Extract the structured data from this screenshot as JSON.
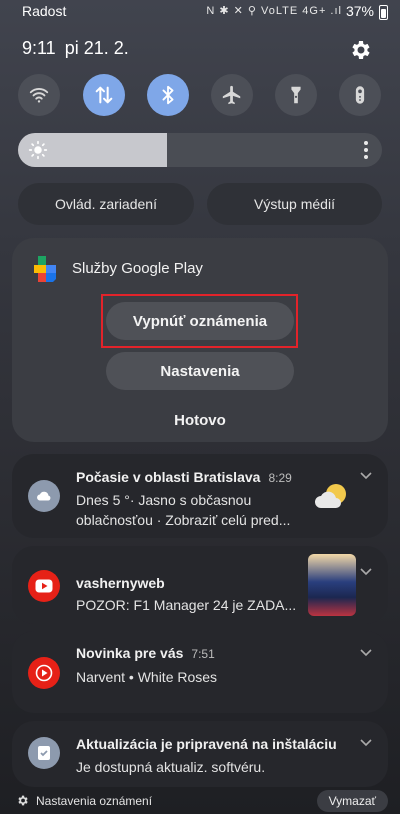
{
  "status_bar": {
    "carrier": "Radost",
    "icons_text": "N ✱ ✕ ⚲ VoLTE 4G+ .ıl",
    "battery": "37%"
  },
  "header": {
    "time": "9:11",
    "date": "pi 21. 2."
  },
  "quick_settings": [
    {
      "name": "wifi-icon",
      "active": false
    },
    {
      "name": "mobile-data-icon",
      "active": true
    },
    {
      "name": "bluetooth-icon",
      "active": true
    },
    {
      "name": "airplane-mode-icon",
      "active": false
    },
    {
      "name": "flashlight-icon",
      "active": false
    },
    {
      "name": "remote-icon",
      "active": false
    }
  ],
  "brightness": {
    "level": 0.41
  },
  "controls": {
    "device_control": "Ovlád. zariadení",
    "media_output": "Výstup médií"
  },
  "dialog": {
    "app_name": "Služby Google Play",
    "turn_off": "Vypnúť oznámenia",
    "settings": "Nastavenia",
    "done": "Hotovo"
  },
  "notifications": [
    {
      "title": "Počasie v oblasti Bratislava",
      "time": "8:29",
      "line1": "Dnes 5 °· Jasno s občasnou",
      "line2": "oblačnosťou · Zobraziť celú pred..."
    },
    {
      "title": "vashernyweb",
      "body": "POZOR: F1 Manager 24 je ZADA..."
    },
    {
      "title": "Novinka pre vás",
      "time": "7:51",
      "body": "Narvent • White Roses"
    },
    {
      "title": "Aktualizácia je pripravená na inštaláciu",
      "body": "Je dostupná aktualiz. softvéru."
    }
  ],
  "footer": {
    "label": "Nastavenia oznámení",
    "clear": "Vymazať"
  },
  "colors": {
    "accent": "#7fa7e8",
    "highlight": "#e2232a",
    "youtube_red": "#e62117"
  }
}
